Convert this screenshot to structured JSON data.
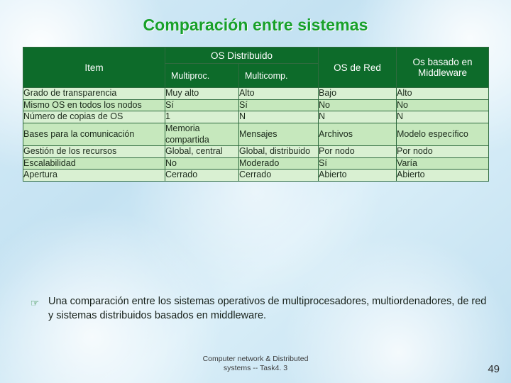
{
  "slide": {
    "title": "Comparación entre sistemas",
    "page_number": "49",
    "footer_line1": "Computer network & Distributed",
    "footer_line2": "systems -- Task4. 3",
    "bullet_marker": "☞",
    "bullet_text": "Una comparación entre los sistemas operativos de multiprocesadores, multiordenadores, de red y sistemas distribuidos basados en middleware."
  },
  "table": {
    "header": {
      "item": "Item",
      "group_distribuido": "OS Distribuido",
      "sub_multiproc": "Multiproc.",
      "sub_multicomp": "Multicomp.",
      "os_red": "OS de Red",
      "middleware": "Os basado en Middleware"
    },
    "rows": [
      {
        "item": "Grado de transparencia",
        "multiproc": "Muy alto",
        "multicomp": "Alto",
        "red": "Bajo",
        "middleware": "Alto"
      },
      {
        "item": "Mismo OS en todos los nodos",
        "multiproc": "Sí",
        "multicomp": "Sí",
        "red": "No",
        "middleware": "No"
      },
      {
        "item": "Número de copias de OS",
        "multiproc": "1",
        "multicomp": "N",
        "red": "N",
        "middleware": "N"
      },
      {
        "item": "Bases para la comunicación",
        "multiproc": "Memoria compartida",
        "multicomp": "Mensajes",
        "red": "Archivos",
        "middleware": "Modelo específico"
      },
      {
        "item": "Gestión de los recursos",
        "multiproc": "Global, central",
        "multicomp": "Global, distribuido",
        "red": "Por nodo",
        "middleware": "Por nodo"
      },
      {
        "item": "Escalabilidad",
        "multiproc": "No",
        "multicomp": "Moderado",
        "red": "Sí",
        "middleware": "Varía"
      },
      {
        "item": "Apertura",
        "multiproc": "Cerrado",
        "multicomp": "Cerrado",
        "red": "Abierto",
        "middleware": "Abierto"
      }
    ]
  },
  "colors": {
    "title": "#17a02a",
    "header_bg": "#0d6b2a",
    "row_bg": "#d9f0d2",
    "row_alt_bg": "#c6e8bd",
    "border": "#2f6b3f",
    "background": "#cfe8f5"
  }
}
